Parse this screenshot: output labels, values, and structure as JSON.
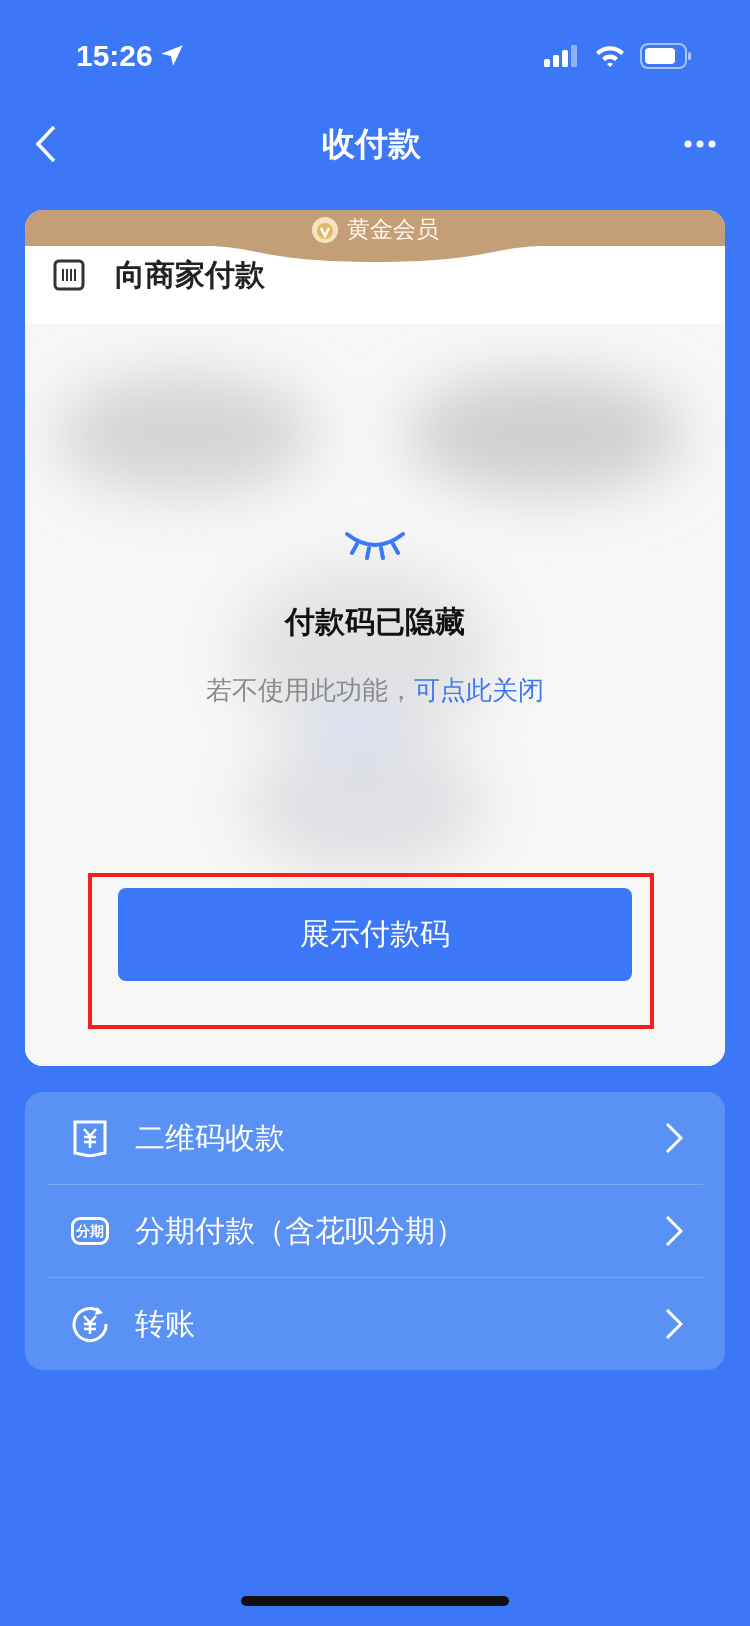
{
  "status_bar": {
    "time": "15:26"
  },
  "nav": {
    "title": "收付款"
  },
  "pay_card": {
    "badge": "黄金会员",
    "title": "向商家付款",
    "hidden_title": "付款码已隐藏",
    "hint": "若不使用此功能，",
    "hint_link": "可点此关闭",
    "button": "展示付款码",
    "highlighted": true
  },
  "menu": [
    {
      "kind": "qr",
      "label": "二维码收款"
    },
    {
      "kind": "installment",
      "icon_label": "分期",
      "label": "分期付款（含花呗分期）"
    },
    {
      "kind": "transfer",
      "label": "转账"
    }
  ]
}
